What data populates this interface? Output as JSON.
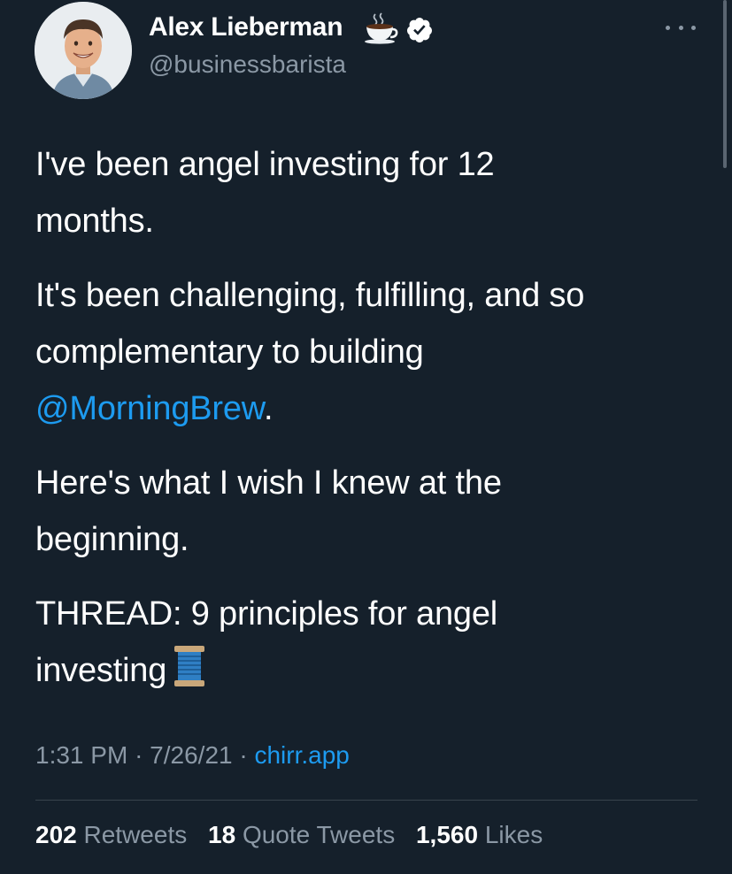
{
  "author": {
    "name": "Alex Lieberman",
    "handle": "@businessbarista",
    "name_emoji": "coffee-icon",
    "verified_icon": "verified-badge-icon"
  },
  "tweet": {
    "para1_line1": "I've been angel investing for 12",
    "para1_line2": "months.",
    "para2_line1": "It's been challenging, fulfilling, and so",
    "para2_line2": "complementary to building",
    "para2_mention": "@MorningBrew",
    "para2_suffix": ".",
    "para3_line1": "Here's what I wish I knew at the",
    "para3_line2": "beginning.",
    "para4_line1": "THREAD: 9 principles for angel",
    "para4_line2": "investing",
    "para4_emoji": "thread-spool-icon"
  },
  "meta": {
    "time": "1:31 PM",
    "date": "7/26/21",
    "separator": "·",
    "source": "chirr.app"
  },
  "stats": {
    "retweets_count": "202",
    "retweets_label": "Retweets",
    "quotes_count": "18",
    "quotes_label": "Quote Tweets",
    "likes_count": "1,560",
    "likes_label": "Likes"
  },
  "colors": {
    "background": "#15202b",
    "text": "#ffffff",
    "secondary": "#8b98a5",
    "link": "#1d9bf0",
    "divider": "#38444d"
  }
}
